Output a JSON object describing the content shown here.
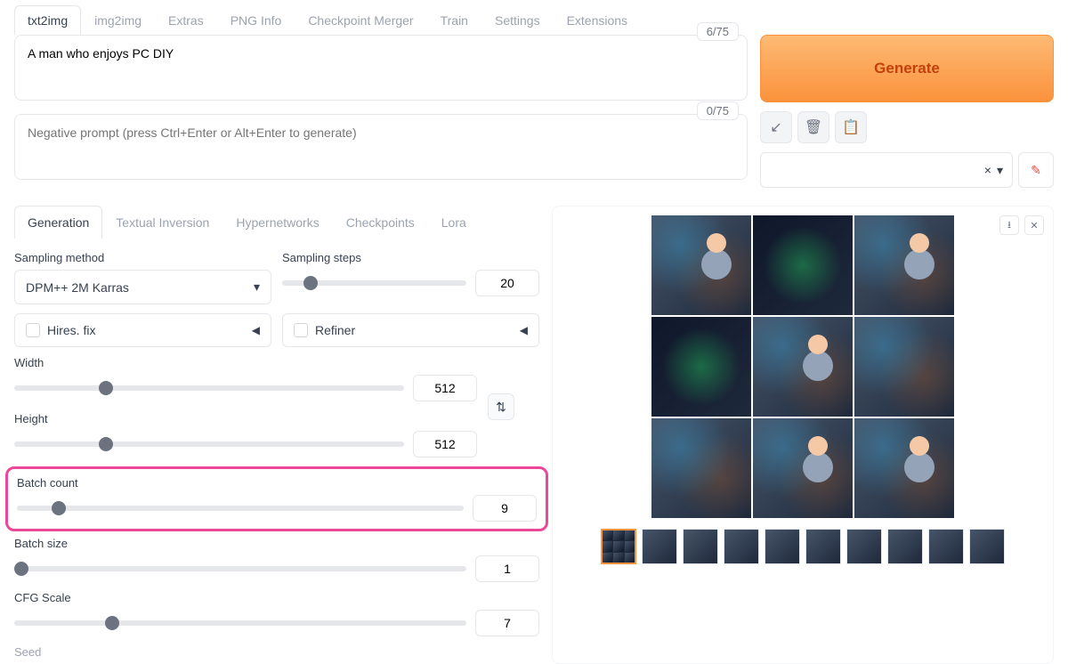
{
  "tabs": {
    "items": [
      "txt2img",
      "img2img",
      "Extras",
      "PNG Info",
      "Checkpoint Merger",
      "Train",
      "Settings",
      "Extensions"
    ],
    "active": 0
  },
  "prompt": {
    "value": "A man who enjoys PC DIY",
    "tokens": "6/75",
    "neg_placeholder": "Negative prompt (press Ctrl+Enter or Alt+Enter to generate)",
    "neg_tokens": "0/75"
  },
  "generate_label": "Generate",
  "sub_tabs": {
    "items": [
      "Generation",
      "Textual Inversion",
      "Hypernetworks",
      "Checkpoints",
      "Lora"
    ],
    "active": 0
  },
  "params": {
    "sampling_method_label": "Sampling method",
    "sampling_method_value": "DPM++ 2M Karras",
    "sampling_steps_label": "Sampling steps",
    "sampling_steps_value": "20",
    "hires_label": "Hires. fix",
    "refiner_label": "Refiner",
    "width_label": "Width",
    "width_value": "512",
    "height_label": "Height",
    "height_value": "512",
    "batch_count_label": "Batch count",
    "batch_count_value": "9",
    "batch_size_label": "Batch size",
    "batch_size_value": "1",
    "cfg_label": "CFG Scale",
    "cfg_value": "7",
    "seed_label": "Seed"
  },
  "style_clear": "×",
  "style_caret": "▾"
}
